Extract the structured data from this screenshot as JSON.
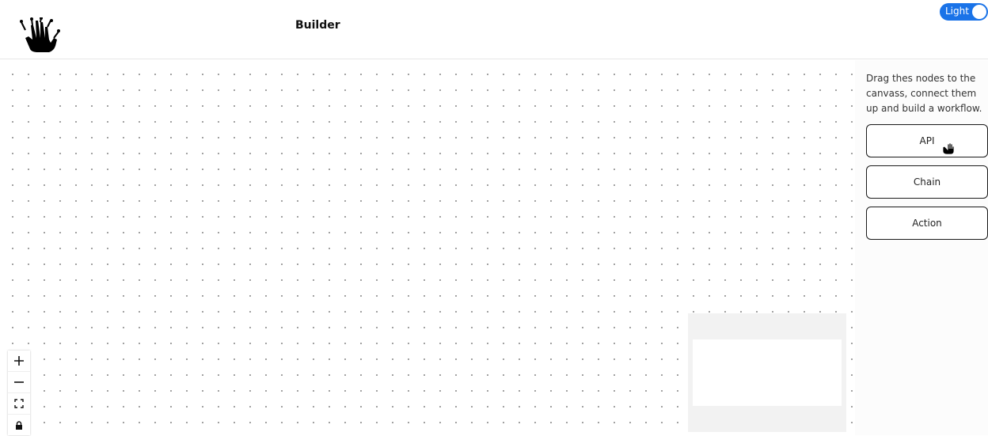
{
  "header": {
    "title": "Builder",
    "logo_icon": "hand-logo-icon",
    "theme_toggle_label": "Light"
  },
  "sidebar": {
    "description": "Drag thes nodes to the canvass, connect them up and build a workflow.",
    "nodes": [
      {
        "label": "API"
      },
      {
        "label": "Chain"
      },
      {
        "label": "Action"
      }
    ]
  },
  "canvas": {
    "controls": [
      {
        "icon": "plus-icon",
        "name": "zoom-in"
      },
      {
        "icon": "minus-icon",
        "name": "zoom-out"
      },
      {
        "icon": "fit-view-icon",
        "name": "fit-view"
      },
      {
        "icon": "lock-icon",
        "name": "toggle-interactivity"
      }
    ]
  },
  "colors": {
    "accent": "#1a73e8",
    "grid_dot": "#9a9a9a",
    "minimap_bg": "#f2f2f2"
  }
}
